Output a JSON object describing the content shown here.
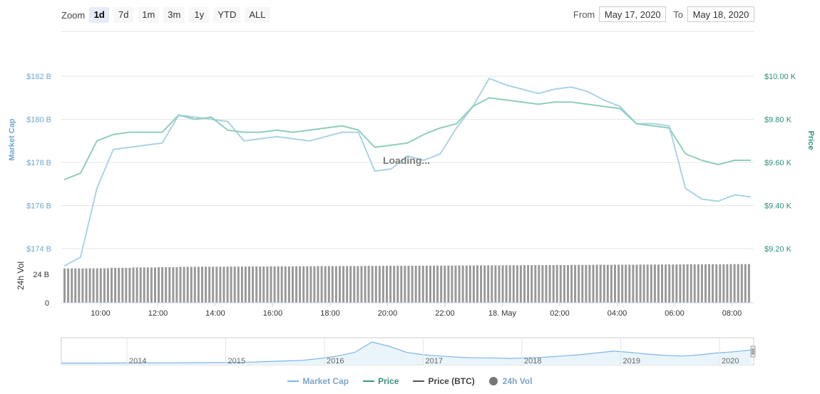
{
  "toolbar": {
    "zoom_label": "Zoom",
    "zoom_buttons": [
      "1d",
      "7d",
      "1m",
      "3m",
      "1y",
      "YTD",
      "ALL"
    ],
    "active_zoom": "1d",
    "from_label": "From",
    "from_value": "May 17, 2020",
    "to_label": "To",
    "to_value": "May 18, 2020"
  },
  "loading_text": "Loading...",
  "colors": {
    "market_cap": "#7cb5ec",
    "market_cap_light": "#a9d3e8",
    "price": "#2f9e88",
    "price_light": "#90cfb9",
    "price_btc": "#555555",
    "volume": "#999999",
    "grid": "#e6e6e6"
  },
  "chart_data": [
    {
      "type": "line",
      "title": "",
      "x_ticks": [
        "10:00",
        "12:00",
        "14:00",
        "16:00",
        "18:00",
        "20:00",
        "22:00",
        "18. May",
        "02:00",
        "04:00",
        "06:00",
        "08:00"
      ],
      "x_range": [
        "08:40",
        "08:35"
      ],
      "y_left": {
        "label": "Market Cap",
        "ticks": [
          "$174 B",
          "$176 B",
          "$178 B",
          "$180 B",
          "$182 B"
        ],
        "range": [
          174,
          182
        ]
      },
      "y_right": {
        "label": "Price",
        "ticks": [
          "$9.20 K",
          "$9.40 K",
          "$9.60 K",
          "$9.80 K",
          "$10.00 K"
        ],
        "range": [
          9200,
          10000
        ]
      },
      "grid": true,
      "series": [
        {
          "name": "Market Cap",
          "unit": "B USD",
          "values": [
            173.2,
            173.6,
            176.8,
            178.6,
            178.7,
            178.8,
            178.9,
            180.2,
            180.1,
            180.0,
            179.9,
            179.0,
            179.1,
            179.2,
            179.1,
            179.0,
            179.2,
            179.4,
            179.4,
            177.6,
            177.7,
            178.3,
            178.1,
            178.4,
            179.6,
            180.6,
            181.9,
            181.6,
            181.4,
            181.2,
            181.4,
            181.5,
            181.3,
            180.9,
            180.6,
            179.8,
            179.8,
            179.7,
            176.8,
            176.3,
            176.2,
            176.5,
            176.4
          ]
        },
        {
          "name": "Price",
          "unit": "K USD",
          "values": [
            9.52,
            9.55,
            9.7,
            9.73,
            9.74,
            9.74,
            9.74,
            9.82,
            9.8,
            9.81,
            9.75,
            9.74,
            9.74,
            9.75,
            9.74,
            9.75,
            9.76,
            9.77,
            9.75,
            9.67,
            9.68,
            9.69,
            9.73,
            9.76,
            9.78,
            9.86,
            9.9,
            9.89,
            9.88,
            9.87,
            9.88,
            9.88,
            9.87,
            9.86,
            9.85,
            9.78,
            9.77,
            9.76,
            9.64,
            9.61,
            9.59,
            9.61,
            9.61
          ]
        }
      ]
    },
    {
      "type": "bar",
      "title": "",
      "ylabel": "24h Vol",
      "y_ticks": [
        "0",
        "24 B"
      ],
      "y_range": [
        0,
        48
      ],
      "series": [
        {
          "name": "24h Vol",
          "unit": "B USD",
          "values": [
            30.5,
            30.6,
            31.0,
            31.3,
            31.6,
            31.9,
            32.0,
            32.1,
            32.2,
            32.3,
            32.4,
            32.5,
            32.6,
            32.7,
            32.8,
            32.9,
            33.0,
            33.1,
            33.2,
            33.3,
            33.4,
            33.5,
            33.6,
            33.7,
            33.8,
            33.9,
            34.0,
            34.1,
            34.2,
            34.3
          ]
        }
      ]
    },
    {
      "type": "area",
      "title": "",
      "name": "navigator",
      "x_ticks": [
        "2014",
        "2015",
        "2016",
        "2017",
        "2018",
        "2019",
        "2020"
      ],
      "values": [
        0.5,
        0.5,
        0.5,
        0.6,
        0.7,
        0.7,
        0.8,
        1.0,
        1.2,
        1.3,
        1.5,
        2,
        3,
        4,
        5,
        8,
        12,
        18,
        35,
        28,
        18,
        14,
        12,
        10,
        9,
        9,
        8,
        9,
        10,
        12,
        14,
        17,
        20,
        18,
        15,
        13,
        12,
        14,
        17,
        19,
        22
      ]
    }
  ],
  "legend": [
    {
      "label": "Market Cap",
      "kind": "line",
      "color": "#7cb5ec"
    },
    {
      "label": "Price",
      "kind": "line",
      "color": "#2f9e88"
    },
    {
      "label": "Price (BTC)",
      "kind": "line",
      "color": "#555555"
    },
    {
      "label": "24h Vol",
      "kind": "dot",
      "color": "#777777"
    }
  ]
}
